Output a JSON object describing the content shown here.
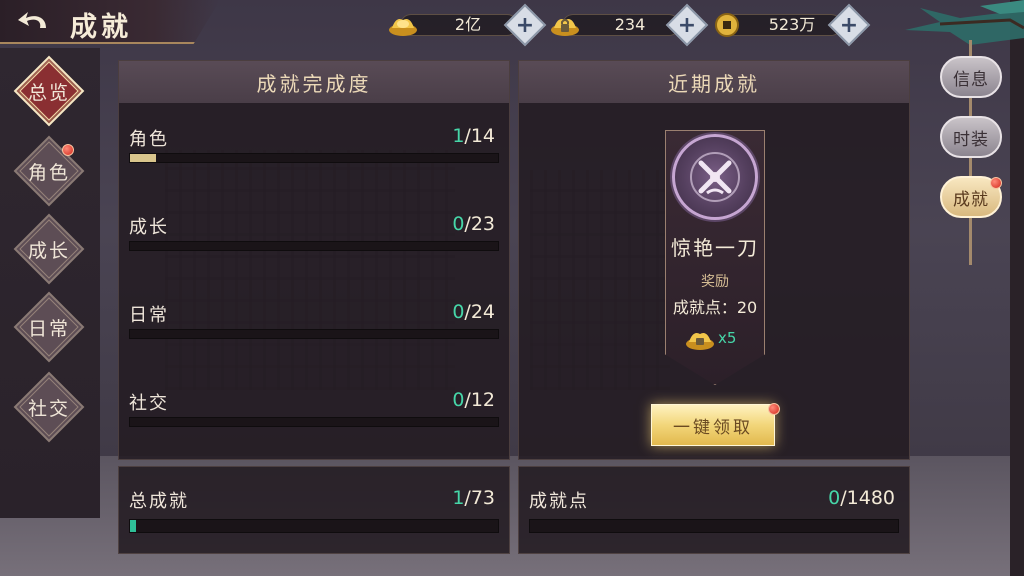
{
  "header": {
    "title": "成就"
  },
  "currencies": [
    {
      "icon": "gold-ingot-icon",
      "value": "2亿"
    },
    {
      "icon": "bound-gold-ingot-icon",
      "value": "234"
    },
    {
      "icon": "copper-coin-icon",
      "value": "523万"
    }
  ],
  "nav": {
    "items": [
      {
        "label": "总览",
        "active": true,
        "badge": false
      },
      {
        "label": "角色",
        "active": false,
        "badge": true
      },
      {
        "label": "成长",
        "active": false,
        "badge": false
      },
      {
        "label": "日常",
        "active": false,
        "badge": false
      },
      {
        "label": "社交",
        "active": false,
        "badge": false
      }
    ]
  },
  "progress_panel": {
    "title": "成就完成度",
    "rows": [
      {
        "label": "角色",
        "done": "1",
        "total": "/14",
        "fraction": 0.0714
      },
      {
        "label": "成长",
        "done": "0",
        "total": "/23",
        "fraction": 0
      },
      {
        "label": "日常",
        "done": "0",
        "total": "/24",
        "fraction": 0
      },
      {
        "label": "社交",
        "done": "0",
        "total": "/12",
        "fraction": 0
      }
    ],
    "summary": {
      "label": "总成就",
      "done": "1",
      "total": "/73",
      "fraction": 0.0137
    }
  },
  "recent_panel": {
    "title": "近期成就",
    "achievement": {
      "name": "惊艳一刀",
      "reward_label": "奖励",
      "points_text": "成就点：20",
      "item_qty": "x5"
    },
    "claim_button": "一键领取",
    "summary": {
      "label": "成就点",
      "done": "0",
      "total": "/1480",
      "fraction": 0
    }
  },
  "side_tabs": [
    {
      "label": "信息",
      "active": false
    },
    {
      "label": "时装",
      "active": false
    },
    {
      "label": "成就",
      "active": true
    }
  ],
  "colors": {
    "accent_done": "#46d6a8",
    "progress_fill": "#d9c58c",
    "summary_fill": "#2fbf98",
    "alert_dot": "#d1281c"
  }
}
